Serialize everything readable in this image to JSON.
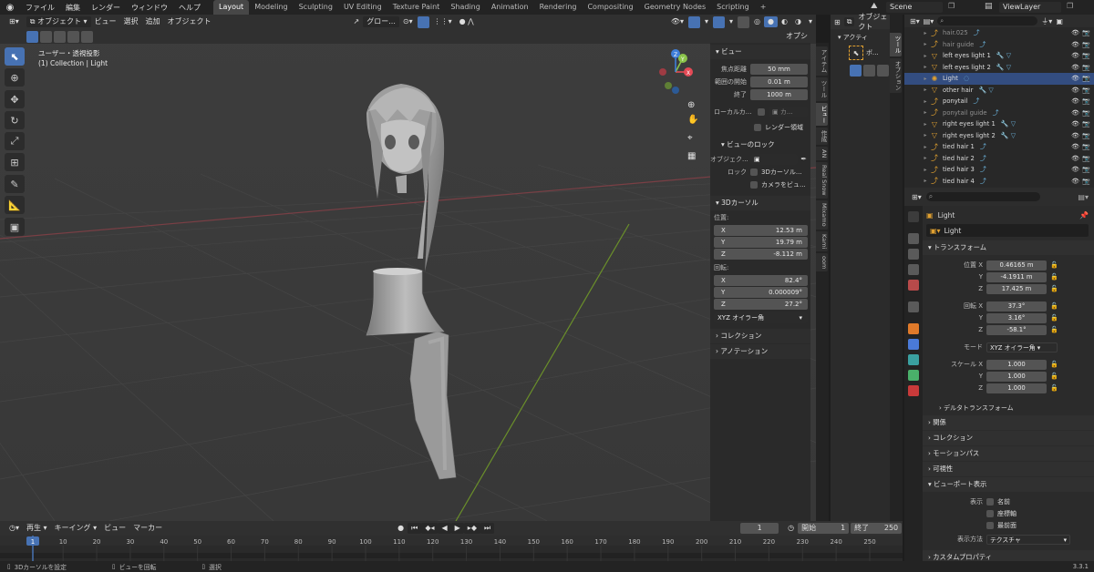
{
  "topbar": {
    "menus": [
      "ファイル",
      "編集",
      "レンダー",
      "ウィンドウ",
      "ヘルプ"
    ],
    "workspaces": [
      "Layout",
      "Modeling",
      "Sculpting",
      "UV Editing",
      "Texture Paint",
      "Shading",
      "Animation",
      "Rendering",
      "Compositing",
      "Geometry Nodes",
      "Scripting"
    ],
    "active_workspace": "Layout",
    "add_tab": "+",
    "scene": "Scene",
    "view_layer": "ViewLayer"
  },
  "viewport_header": {
    "mode": "オブジェクト",
    "menus": [
      "ビュー",
      "選択",
      "追加",
      "オブジェクト"
    ],
    "transform_orientation": "グロー...",
    "options": "オプション"
  },
  "viewport_info": {
    "view": "ユーザー・透視投影",
    "collection": "(1) Collection | Light"
  },
  "gizmo": {
    "x": "X",
    "y": "Y",
    "z": "Z"
  },
  "npanel": {
    "view_section": "ビュー",
    "focal_length_label": "焦点距離",
    "focal_length": "50 mm",
    "clip_start_label": "範囲の開始",
    "clip_start": "0.01 m",
    "clip_end_label": "終了",
    "clip_end": "1000 m",
    "local_camera_label": "ローカルカ...",
    "local_camera_value": "カ...",
    "render_region": "レンダー領域",
    "view_lock": "ビューのロック",
    "lock_object_label": "オブジェク...",
    "lock_label": "ロック",
    "lock_3d_cursor": "3Dカーソル...",
    "lock_camera": "カメラをビュ...",
    "cursor_section": "3Dカーソル",
    "location_label": "位置:",
    "loc": [
      {
        "axis": "X",
        "value": "12.53 m"
      },
      {
        "axis": "Y",
        "value": "19.79 m"
      },
      {
        "axis": "Z",
        "value": "-8.112 m"
      }
    ],
    "rotation_label": "回転:",
    "rot": [
      {
        "axis": "X",
        "value": "82.4°"
      },
      {
        "axis": "Y",
        "value": "0.000009°"
      },
      {
        "axis": "Z",
        "value": "27.2°"
      }
    ],
    "rotation_mode": "XYZ オイラー角",
    "collection_section": "コレクション",
    "annotation_section": "アノテーション",
    "tabs": [
      "アイテム",
      "ツール",
      "ビュー",
      "作成",
      "AN",
      "Real Snow",
      "Mixamo",
      "Kami",
      "oom"
    ]
  },
  "toolcol": {
    "title": "アクティ",
    "tool_name": "ボ...",
    "tabs": [
      "ツール",
      "オプション"
    ]
  },
  "outliner": {
    "rows": [
      {
        "name": "hair.025",
        "icon": "curve",
        "dim": true
      },
      {
        "name": "hair guide",
        "icon": "curve",
        "dim": true
      },
      {
        "name": "left eyes light 1",
        "icon": "mesh"
      },
      {
        "name": "left eyes light 2",
        "icon": "mesh"
      },
      {
        "name": "Light",
        "icon": "light",
        "selected": true
      },
      {
        "name": "other hair",
        "icon": "mesh"
      },
      {
        "name": "ponytail",
        "icon": "curve"
      },
      {
        "name": "ponytail guide",
        "icon": "curve",
        "dim": true
      },
      {
        "name": "right eyes light 1",
        "icon": "mesh"
      },
      {
        "name": "right eyes light 2",
        "icon": "mesh"
      },
      {
        "name": "tied hair 1",
        "icon": "curve"
      },
      {
        "name": "tied hair 2",
        "icon": "curve"
      },
      {
        "name": "tied hair 3",
        "icon": "curve"
      },
      {
        "name": "tied hair 4",
        "icon": "curve"
      },
      {
        "name": "tied hair 5",
        "icon": "curve"
      }
    ]
  },
  "properties": {
    "object_name": "Light",
    "datablock": "Light",
    "transform_section": "トランスフォーム",
    "location_label": "位置 X",
    "location": [
      "0.46165 m",
      "-4.1911 m",
      "17.425 m"
    ],
    "rotation_label": "回転 X",
    "rotation": [
      "37.3°",
      "3.16°",
      "-58.1°"
    ],
    "mode_label": "モード",
    "mode_value": "XYZ オイラー角",
    "scale_label": "スケール X",
    "scale": [
      "1.000",
      "1.000",
      "1.000"
    ],
    "axis_y": "Y",
    "axis_z": "Z",
    "delta_transform": "デルタトランスフォーム",
    "sections": [
      "関係",
      "コレクション",
      "モーションパス",
      "可視性"
    ],
    "viewport_display": "ビューポート表示",
    "display_label": "表示",
    "display_checks": [
      "名前",
      "座標軸",
      "最前面"
    ],
    "display_as_label": "表示方法",
    "display_as": "テクスチャ",
    "custom_props": "カスタムプロパティ"
  },
  "timeline": {
    "playback": "再生",
    "keying": "キーイング",
    "view": "ビュー",
    "marker": "マーカー",
    "current_frame": "1",
    "start_label": "開始",
    "start": "1",
    "end_label": "終了",
    "end": "250",
    "ticks": [
      "1",
      "10",
      "20",
      "30",
      "40",
      "50",
      "60",
      "70",
      "80",
      "90",
      "100",
      "110",
      "120",
      "130",
      "140",
      "150",
      "160",
      "170",
      "180",
      "190",
      "200",
      "210",
      "220",
      "230",
      "240",
      "250"
    ]
  },
  "statusbar": {
    "items": [
      "3Dカーソルを設定",
      "ビューを回転",
      "選択"
    ],
    "version": "3.3.1"
  },
  "colors": {
    "accent": "#4772b3",
    "selected_row": "#334d80",
    "x_axis": "#e54a56",
    "y_axis": "#8bc34a",
    "z_axis": "#3f7fd9"
  }
}
